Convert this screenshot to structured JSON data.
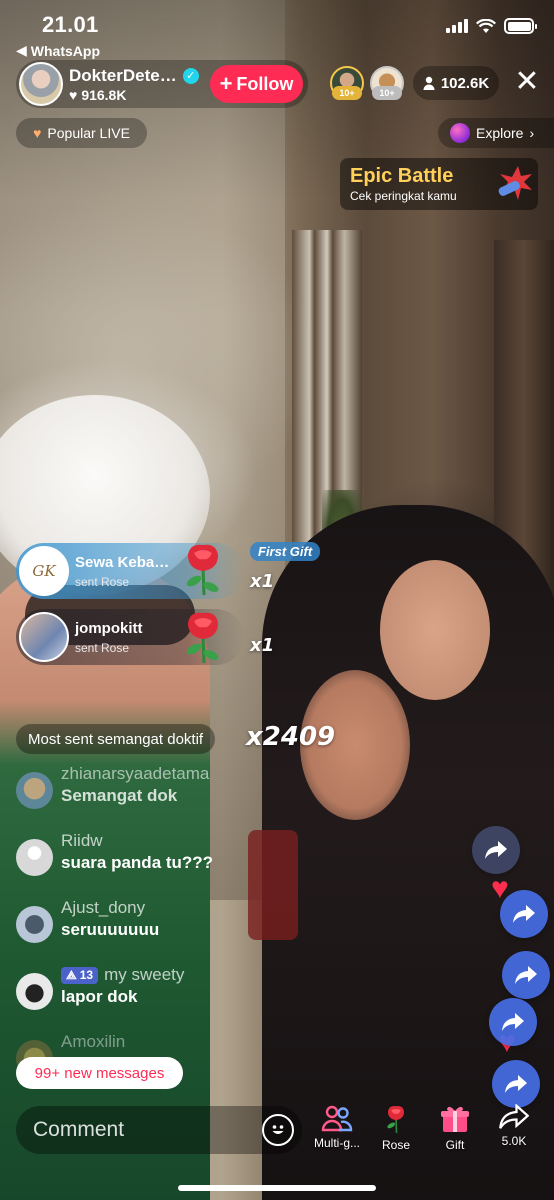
{
  "status_bar": {
    "time": "21.01",
    "back_app": "WhatsApp"
  },
  "host": {
    "name": "DokterDete…",
    "likes": "916.8K",
    "follow_label": "Follow"
  },
  "top_viewers": [
    {
      "badge": "10+"
    },
    {
      "badge": "10+"
    }
  ],
  "viewer_count": "102.6K",
  "popular_label": "Popular LIVE",
  "explore_label": "Explore",
  "epic_battle": {
    "title": "Epic Battle",
    "subtitle": "Cek peringkat kamu"
  },
  "gift_feed": [
    {
      "user": "Sewa Keba…",
      "action": "sent Rose",
      "count": "x1",
      "first_gift": "First Gift"
    },
    {
      "user": "jompokitt",
      "action": "sent Rose",
      "count": "x1"
    }
  ],
  "most_sent": {
    "label": "Most sent semangat doktif",
    "count": "x2409"
  },
  "comments": [
    {
      "user": "zhianarsyaadetama",
      "message": "Semangat dok"
    },
    {
      "user": "Riidw",
      "message": "suara panda tu???"
    },
    {
      "user": "Ajust_dony",
      "message": "seruuuuuuu"
    },
    {
      "user": "my sweety",
      "level": "13",
      "message": "lapor dok"
    },
    {
      "user": "Amoxilin",
      "message": ""
    }
  ],
  "new_messages": "99+ new messages",
  "comment_placeholder": "Comment",
  "toolbar": {
    "multi_guest": "Multi-g...",
    "rose": "Rose",
    "gift": "Gift",
    "share_count": "5.0K"
  },
  "colors": {
    "follow": "#fe2c55",
    "verified": "#20d5ec",
    "share_bubble": "#466ee6",
    "epic_title": "#ffd05a"
  }
}
